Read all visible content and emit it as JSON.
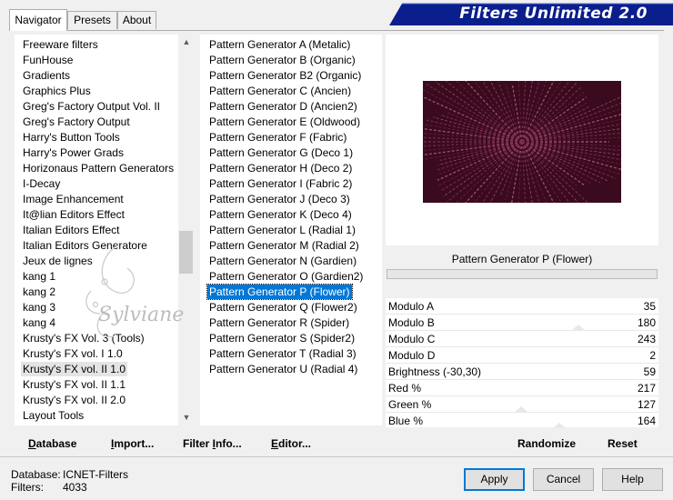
{
  "app": {
    "title": "Filters Unlimited 2.0"
  },
  "tabs": [
    {
      "label": "Navigator",
      "active": true
    },
    {
      "label": "Presets",
      "active": false
    },
    {
      "label": "About",
      "active": false
    }
  ],
  "categories": {
    "selected": "Krusty's FX vol. II 1.0",
    "items": [
      "Freeware filters",
      "FunHouse",
      "Gradients",
      "Graphics Plus",
      "Greg's Factory Output Vol. II",
      "Greg's Factory Output",
      "Harry's Button Tools",
      "Harry's Power Grads",
      "Horizonaus Pattern Generators",
      "I-Decay",
      "Image Enhancement",
      "It@lian Editors Effect",
      "Italian Editors Effect",
      "Italian Editors Generatore",
      "Jeux de lignes",
      "kang 1",
      "kang 2",
      "kang 3",
      "kang 4",
      "Krusty's FX Vol. 3 (Tools)",
      "Krusty's FX vol. I 1.0",
      "Krusty's FX vol. II 1.0",
      "Krusty's FX vol. II 1.1",
      "Krusty's FX vol. II 2.0",
      "Layout Tools"
    ]
  },
  "filters": {
    "selected": "Pattern Generator P (Flower)",
    "items": [
      "Pattern Generator A (Metalic)",
      "Pattern Generator B (Organic)",
      "Pattern Generator B2 (Organic)",
      "Pattern Generator C (Ancien)",
      "Pattern Generator D (Ancien2)",
      "Pattern Generator E (Oldwood)",
      "Pattern Generator F (Fabric)",
      "Pattern Generator G (Deco 1)",
      "Pattern Generator H (Deco 2)",
      "Pattern Generator I (Fabric 2)",
      "Pattern Generator J (Deco 3)",
      "Pattern Generator K (Deco 4)",
      "Pattern Generator L (Radial 1)",
      "Pattern Generator M (Radial 2)",
      "Pattern Generator N (Gardien)",
      "Pattern Generator O (Gardien2)",
      "Pattern Generator P (Flower)",
      "Pattern Generator Q (Flower2)",
      "Pattern Generator R (Spider)",
      "Pattern Generator S (Spider2)",
      "Pattern Generator T (Radial 3)",
      "Pattern Generator U (Radial 4)"
    ]
  },
  "preview": {
    "filter_name": "Pattern Generator P (Flower)",
    "dark_color": "#3a0a1e",
    "light_color": "#9a4a6a"
  },
  "params": [
    {
      "name": "Modulo A",
      "value": "35"
    },
    {
      "name": "Modulo B",
      "value": "180"
    },
    {
      "name": "Modulo C",
      "value": "243"
    },
    {
      "name": "Modulo D",
      "value": "2"
    },
    {
      "name": "Brightness (-30,30)",
      "value": "59"
    },
    {
      "name": "Red %",
      "value": "217"
    },
    {
      "name": "Green %",
      "value": "127"
    },
    {
      "name": "Blue %",
      "value": "164"
    }
  ],
  "toolbar": {
    "database_pre": "D",
    "database_post": "atabase",
    "import_pre": "I",
    "import_post": "mport...",
    "filterinfo_pre": "Filter ",
    "filterinfo_u": "I",
    "filterinfo_post": "nfo...",
    "editor_pre": "E",
    "editor_post": "ditor...",
    "randomize": "Randomize",
    "reset": "Reset"
  },
  "info": {
    "database_label": "Database:",
    "database_value": "ICNET-Filters",
    "filters_label": "Filters:",
    "filters_value": "4033"
  },
  "buttons": {
    "apply": "Apply",
    "cancel": "Cancel",
    "help": "Help"
  },
  "watermark": "Sylviane",
  "colors": {
    "banner": "#0a1e8c",
    "selection": "#0078d7",
    "thumb": "#cdcdcd"
  }
}
